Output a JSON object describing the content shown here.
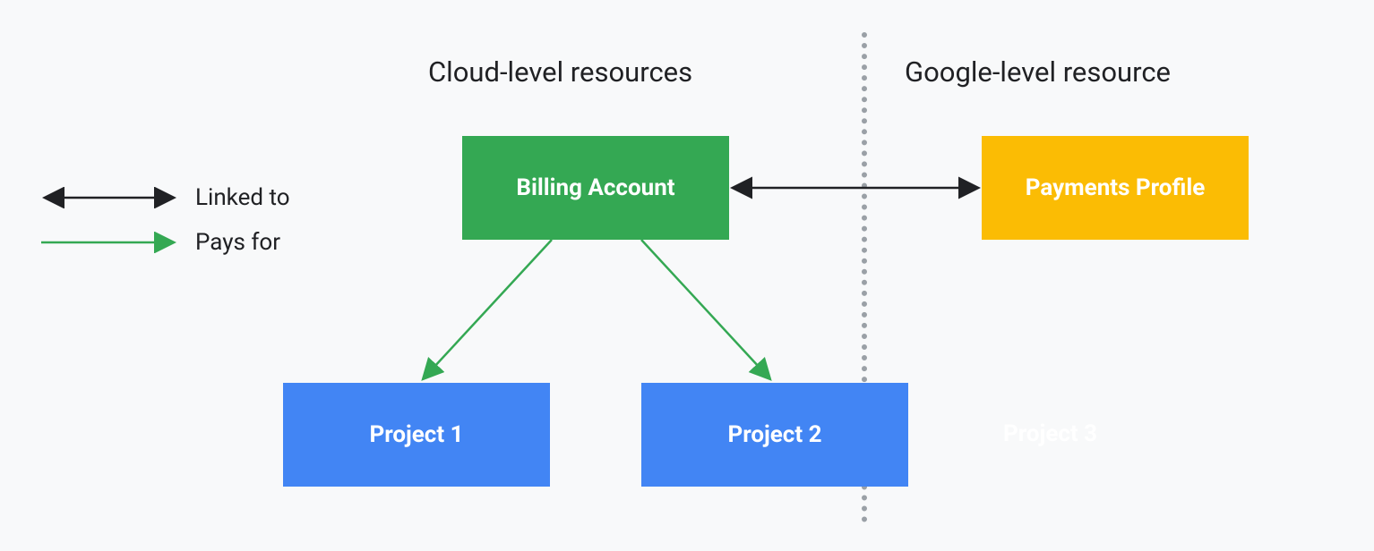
{
  "headings": {
    "cloud": "Cloud-level resources",
    "google": "Google-level resource"
  },
  "nodes": {
    "billing": "Billing Account",
    "payments": "Payments Profile",
    "project1": "Project 1",
    "project2": "Project 2",
    "project3": "Project 3"
  },
  "legend": {
    "linked": "Linked to",
    "pays": "Pays for"
  },
  "colors": {
    "green": "#34a853",
    "yellow": "#fbbc04",
    "blue": "#4285f4",
    "dark": "#202124",
    "gray": "#9aa0a6"
  }
}
